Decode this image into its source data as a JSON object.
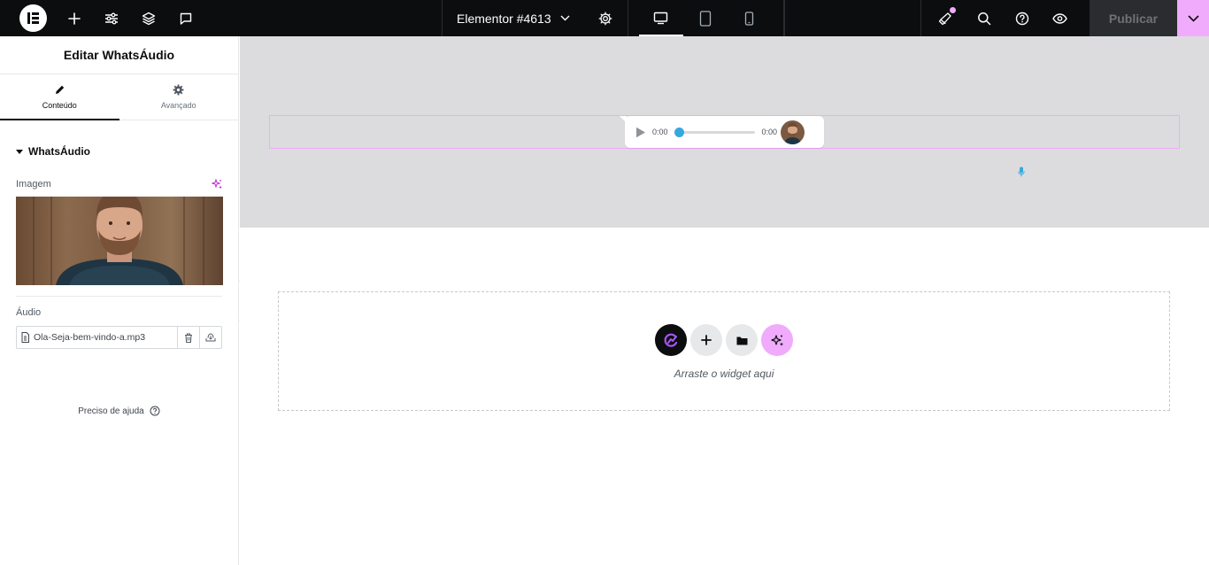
{
  "topbar": {
    "document_title": "Elementor #4613",
    "publish_label": "Publicar",
    "devices": [
      "desktop",
      "tablet",
      "mobile"
    ],
    "active_device": "desktop"
  },
  "panel": {
    "title": "Editar WhatsÁudio",
    "tabs": [
      {
        "label": "Conteúdo",
        "icon": "pencil-icon",
        "active": true
      },
      {
        "label": "Avançado",
        "icon": "gear-icon",
        "active": false
      }
    ],
    "section_title": "WhatsÁudio",
    "image_label": "Imagem",
    "audio_label": "Áudio",
    "audio_file": "Ola-Seja-bem-vindo-a.mp3",
    "help_text": "Preciso de ajuda"
  },
  "canvas": {
    "player": {
      "current_time": "0:00",
      "duration": "0:00",
      "progress": 0
    },
    "drop_zone_text": "Arraste o widget aqui"
  },
  "colors": {
    "accent": "#f0abfc",
    "topbar_bg": "#0c0d0e",
    "player_knob": "#35a8e0"
  }
}
